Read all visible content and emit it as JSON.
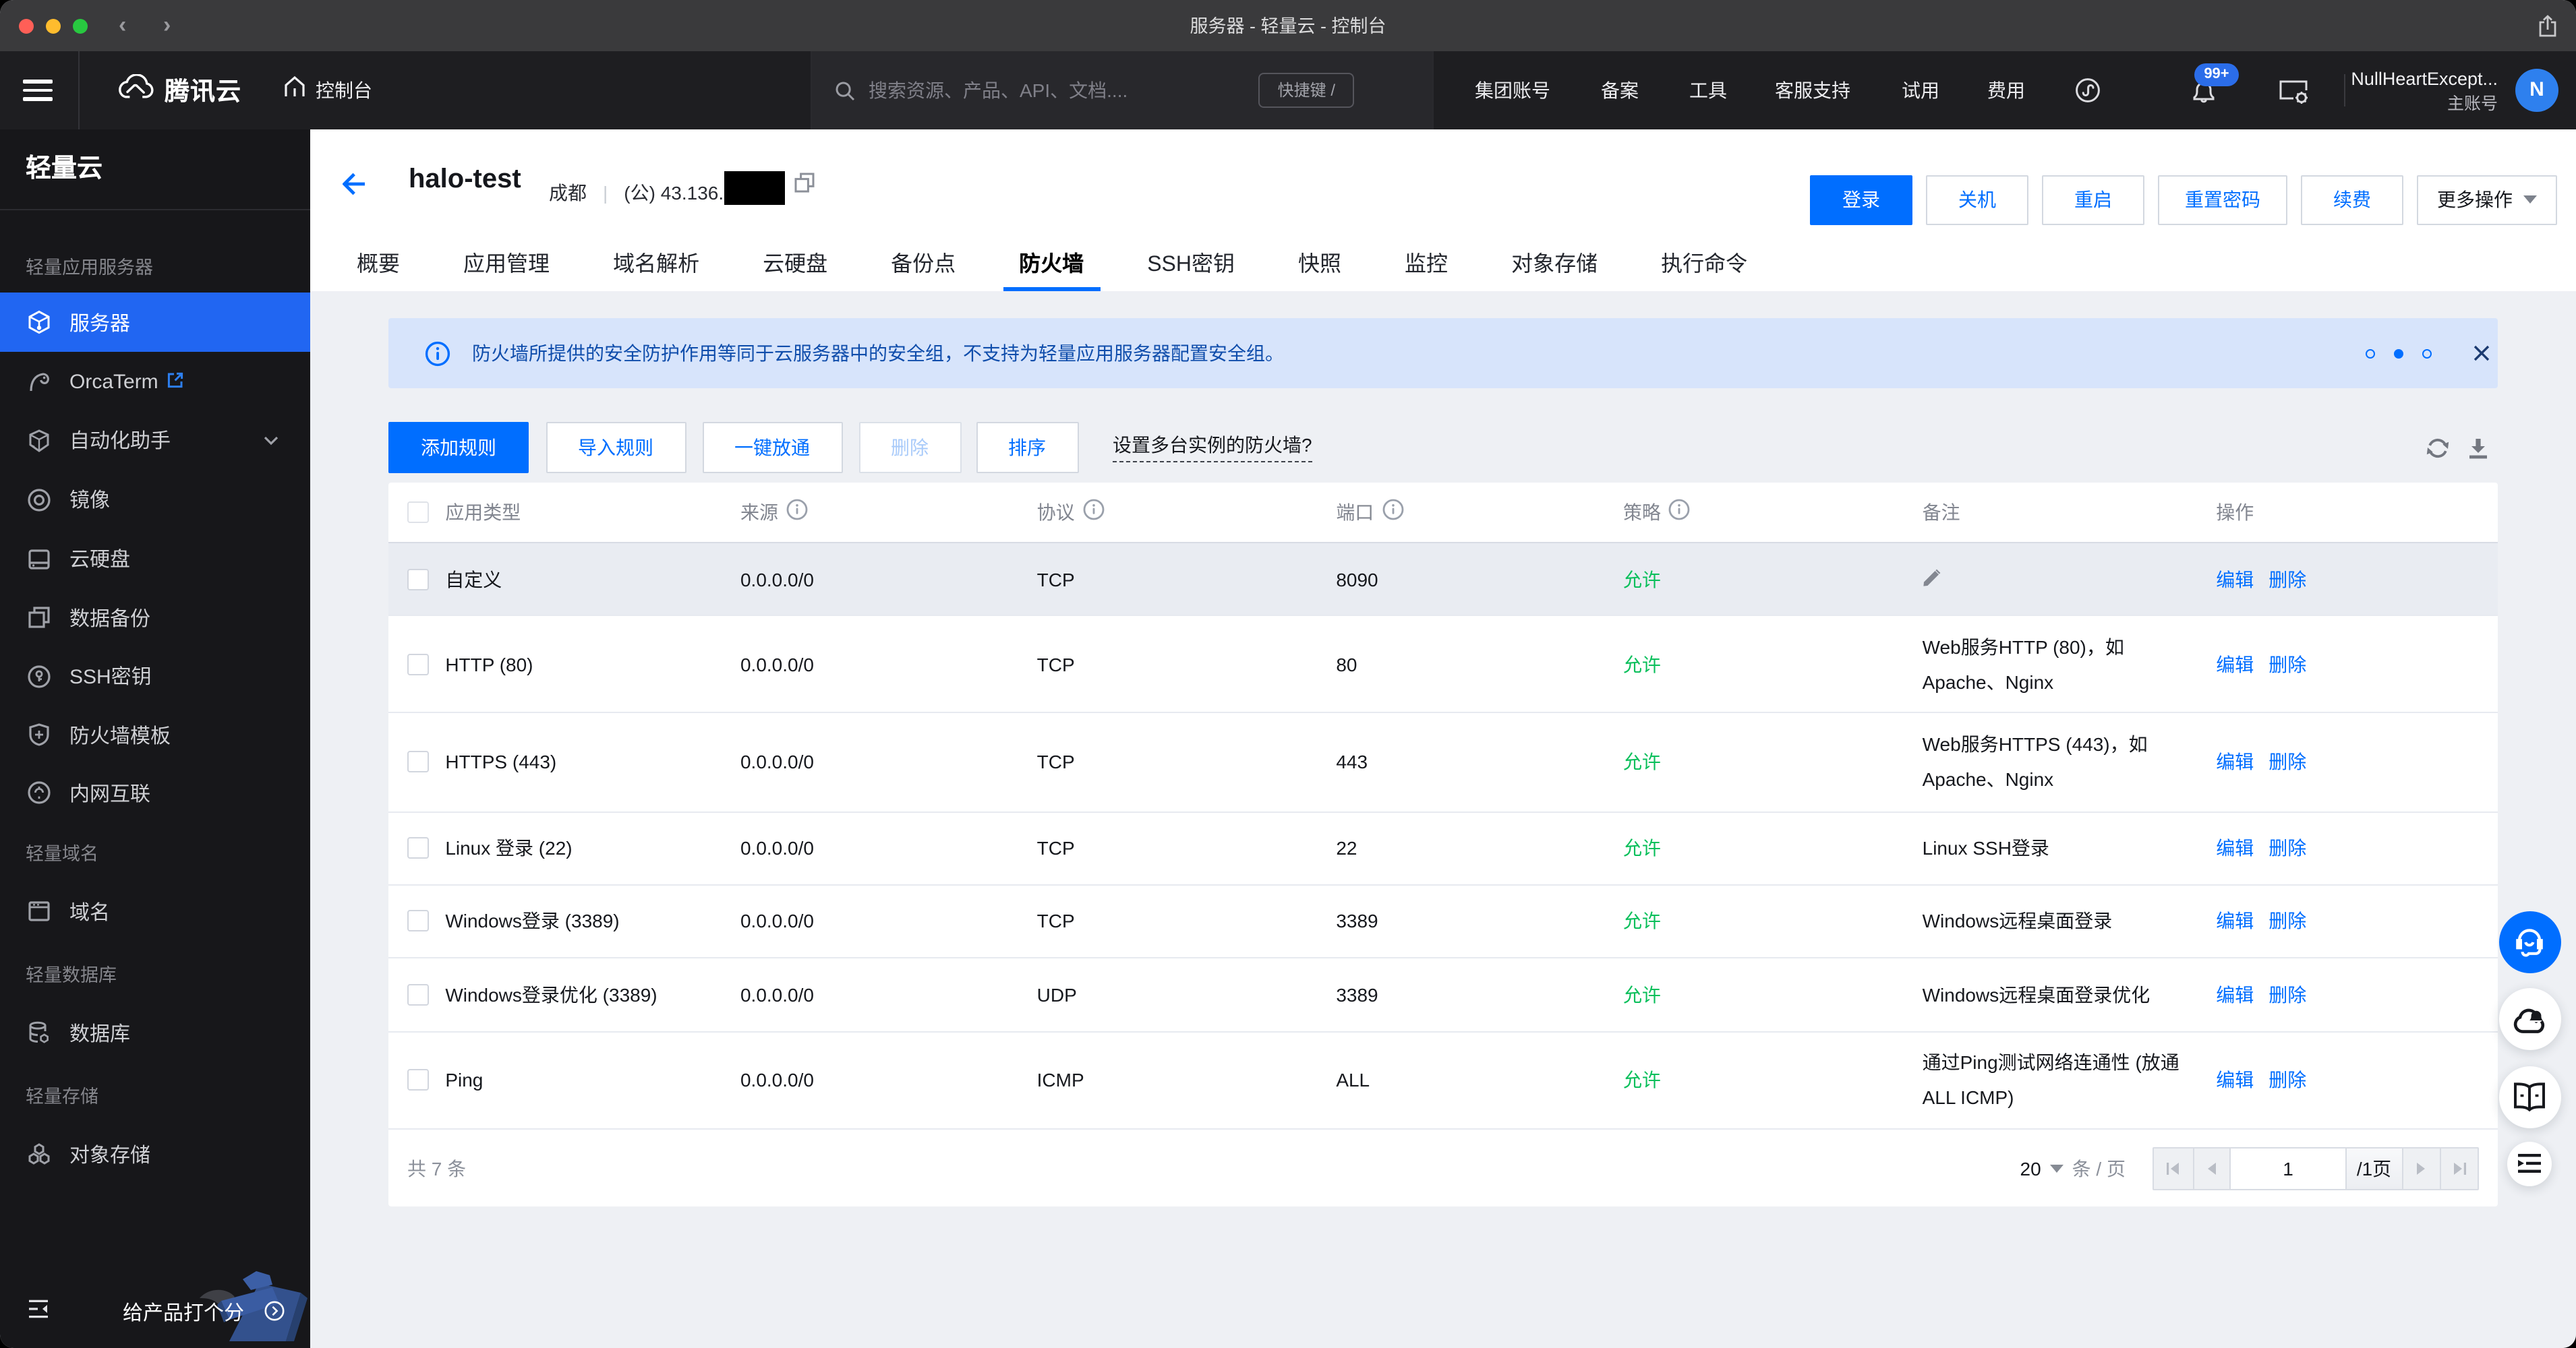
{
  "colors": {
    "primary": "#006eff",
    "success": "#0abf5b",
    "sidebar_active": "#2166f2",
    "banner_bg": "#d7e4fb",
    "banner_text": "#0f4dab"
  },
  "window": {
    "title": "服务器 - 轻量云 - 控制台"
  },
  "topnav": {
    "brand": "腾讯云",
    "console": "控制台",
    "search_placeholder": "搜索资源、产品、API、文档....",
    "shortcut": "快捷键 /",
    "menu": [
      "集团账号",
      "备案",
      "工具",
      "客服支持",
      "试用",
      "费用"
    ],
    "badge": "99+",
    "user": {
      "name": "NullHeartExcept...",
      "role": "主账号",
      "initial": "N"
    }
  },
  "sidebar": {
    "title": "轻量云",
    "groups": [
      {
        "label": "轻量应用服务器"
      },
      {
        "label": "轻量域名"
      },
      {
        "label": "轻量数据库"
      },
      {
        "label": "轻量存储"
      }
    ],
    "items": {
      "server": "服务器",
      "orcaterm": "OrcaTerm",
      "assistant": "自动化助手",
      "image": "镜像",
      "disk": "云硬盘",
      "backup": "数据备份",
      "sshkey": "SSH密钥",
      "fwtemplate": "防火墙模板",
      "privnet": "内网互联",
      "domain": "域名",
      "database": "数据库",
      "cos": "对象存储"
    },
    "rate": "给产品打个分"
  },
  "page": {
    "name": "halo-test",
    "region": "成都",
    "divider": "|",
    "ip_prefix": "(公) 43.136.",
    "actions": {
      "login": "登录",
      "shutdown": "关机",
      "restart": "重启",
      "resetpwd": "重置密码",
      "renew": "续费",
      "more": "更多操作"
    }
  },
  "tabs": [
    "概要",
    "应用管理",
    "域名解析",
    "云硬盘",
    "备份点",
    "防火墙",
    "SSH密钥",
    "快照",
    "监控",
    "对象存储",
    "执行命令"
  ],
  "banner": {
    "text": "防火墙所提供的安全防护作用等同于云服务器中的安全组，不支持为轻量应用服务器配置安全组。"
  },
  "toolbar": {
    "add": "添加规则",
    "import": "导入规则",
    "openall": "一键放通",
    "delete": "删除",
    "sort": "排序",
    "link": "设置多台实例的防火墙?"
  },
  "table": {
    "columns": {
      "app": "应用类型",
      "source": "来源",
      "protocol": "协议",
      "port": "端口",
      "policy": "策略",
      "remark": "备注",
      "action": "操作"
    },
    "edit": "编辑",
    "del": "删除",
    "rows": [
      {
        "app": "自定义",
        "source": "0.0.0.0/0",
        "protocol": "TCP",
        "port": "8090",
        "policy": "允许",
        "remark": []
      },
      {
        "app": "HTTP (80)",
        "source": "0.0.0.0/0",
        "protocol": "TCP",
        "port": "80",
        "policy": "允许",
        "remark": [
          "Web服务HTTP (80)，如",
          "Apache、Nginx"
        ]
      },
      {
        "app": "HTTPS (443)",
        "source": "0.0.0.0/0",
        "protocol": "TCP",
        "port": "443",
        "policy": "允许",
        "remark": [
          "Web服务HTTPS (443)，如",
          "Apache、Nginx"
        ]
      },
      {
        "app": "Linux 登录 (22)",
        "source": "0.0.0.0/0",
        "protocol": "TCP",
        "port": "22",
        "policy": "允许",
        "remark": [
          "Linux SSH登录"
        ]
      },
      {
        "app": "Windows登录 (3389)",
        "source": "0.0.0.0/0",
        "protocol": "TCP",
        "port": "3389",
        "policy": "允许",
        "remark": [
          "Windows远程桌面登录"
        ]
      },
      {
        "app": "Windows登录优化 (3389)",
        "source": "0.0.0.0/0",
        "protocol": "UDP",
        "port": "3389",
        "policy": "允许",
        "remark": [
          "Windows远程桌面登录优化"
        ]
      },
      {
        "app": "Ping",
        "source": "0.0.0.0/0",
        "protocol": "ICMP",
        "port": "ALL",
        "policy": "允许",
        "remark": [
          "通过Ping测试网络连通性 (放通",
          "ALL ICMP)"
        ]
      }
    ],
    "footer": {
      "total": "共 7 条",
      "page_size": "20",
      "per_page": "条 / 页",
      "page": "1",
      "page_total": "/1页"
    }
  }
}
